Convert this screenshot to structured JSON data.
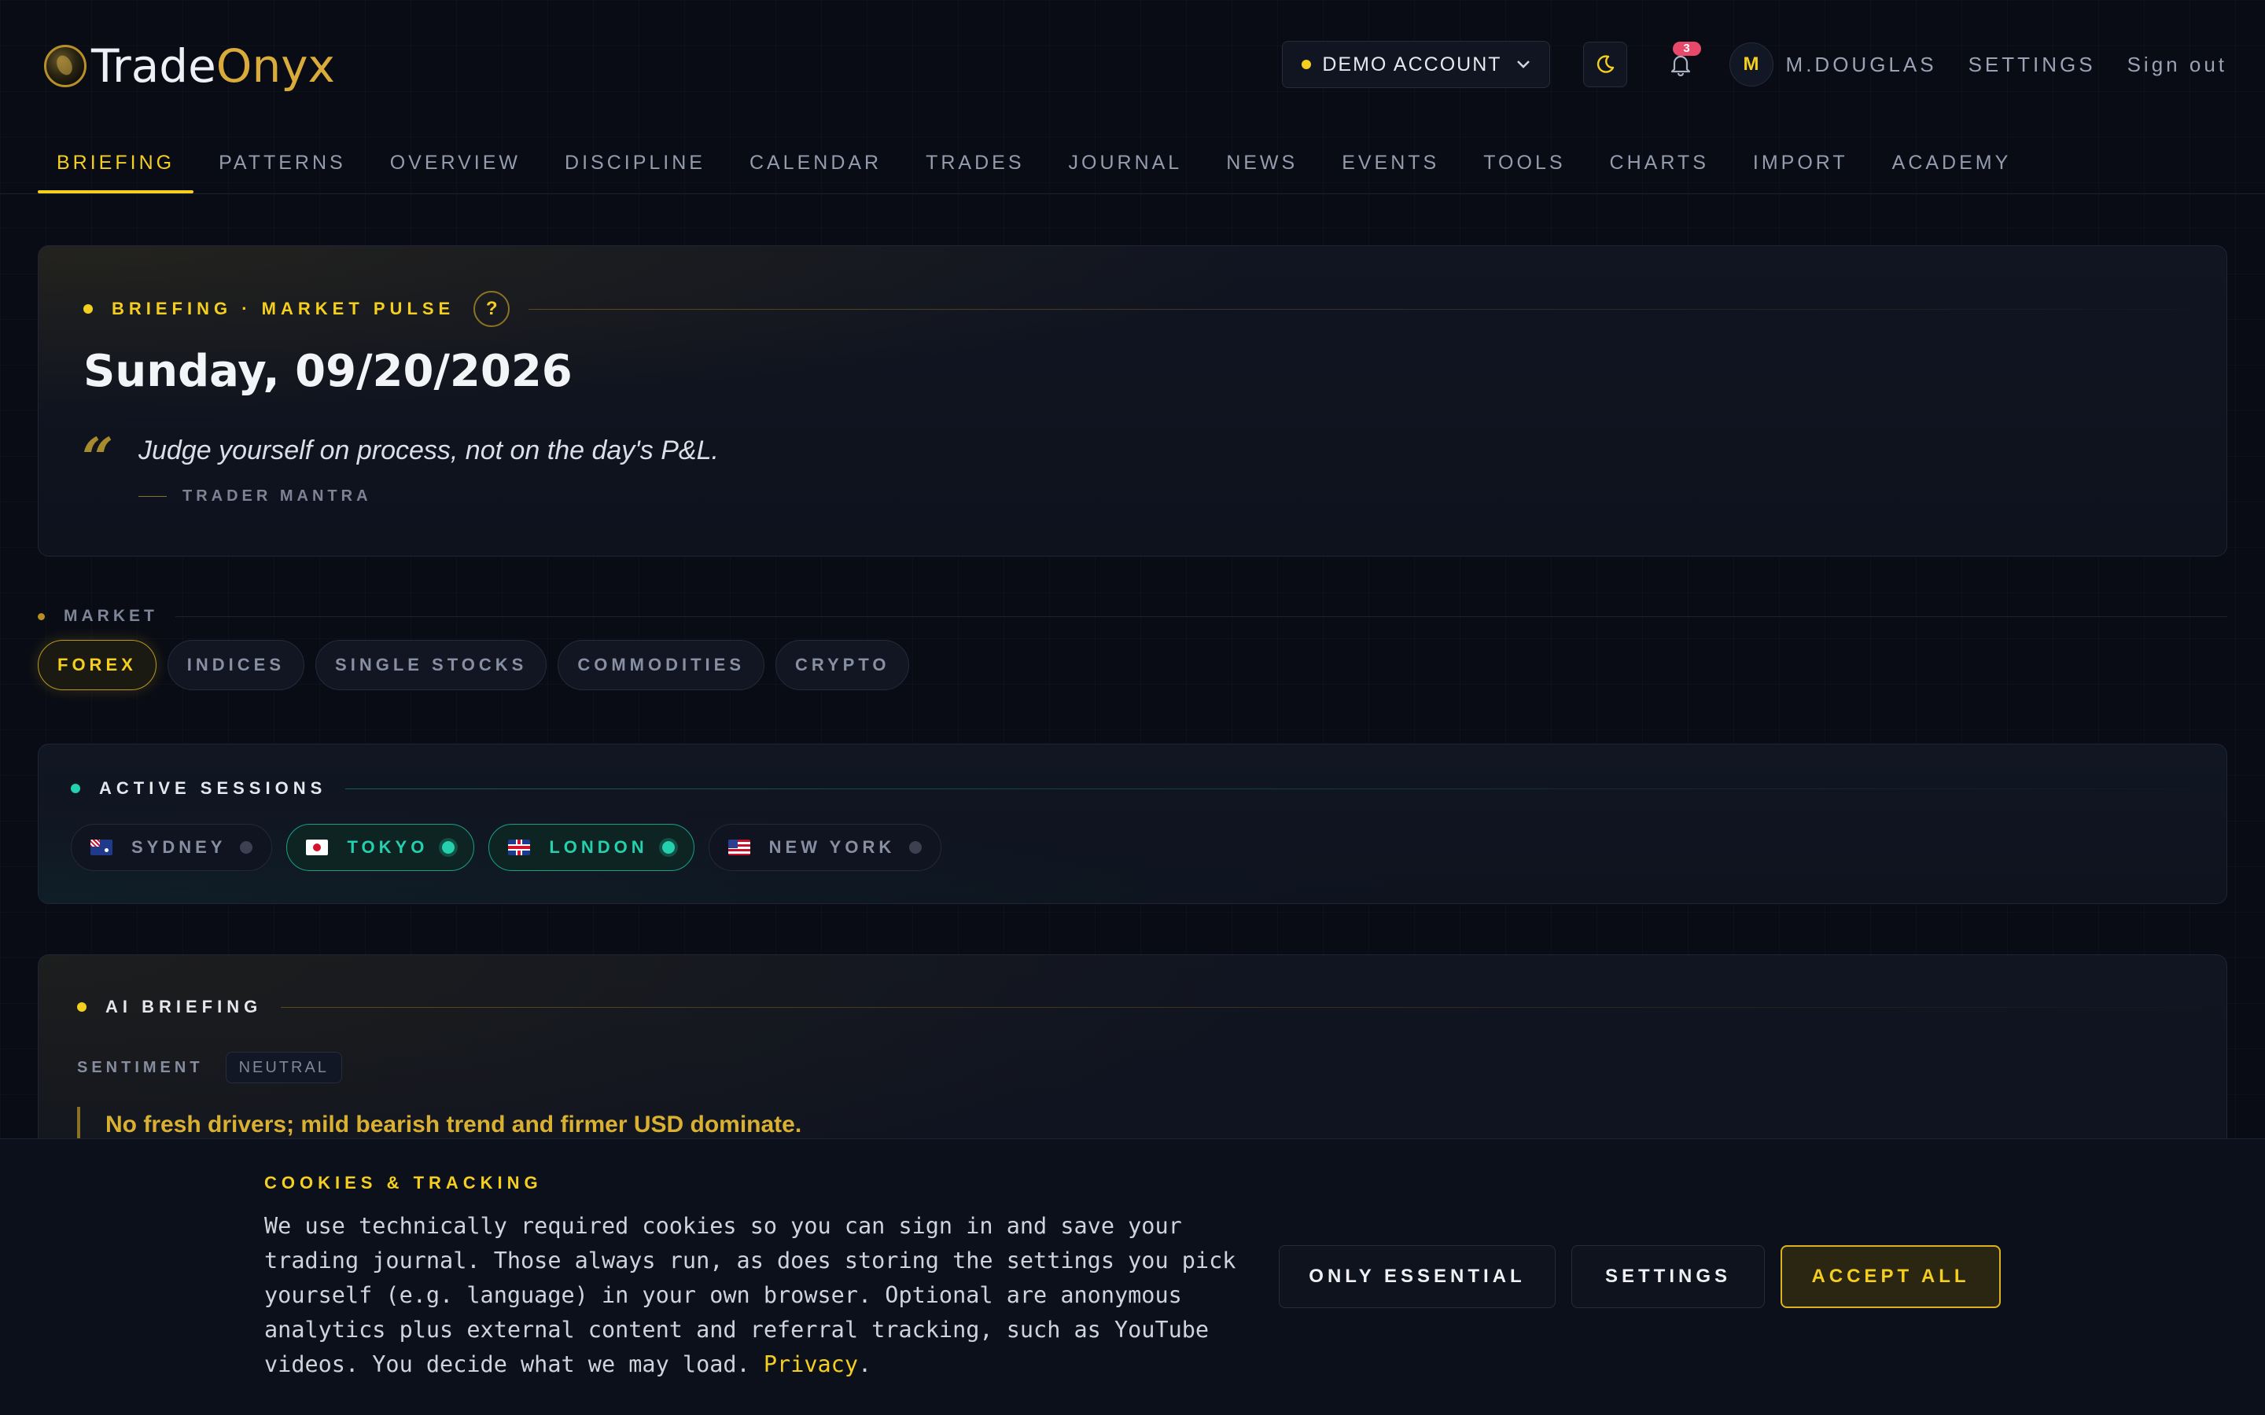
{
  "brand": {
    "part1": "Trade",
    "part2": "Onyx",
    "accent": "#d9ab3a"
  },
  "header": {
    "account_label": "DEMO ACCOUNT",
    "notifications_count": "3",
    "avatar_initial": "M",
    "username": "M.DOUGLAS",
    "settings_label": "SETTINGS",
    "signout_label": "Sign out",
    "icons": [
      "moon-icon",
      "bell-icon",
      "chevron-down-icon"
    ]
  },
  "nav": {
    "items": [
      "BRIEFING",
      "PATTERNS",
      "OVERVIEW",
      "DISCIPLINE",
      "CALENDAR",
      "TRADES",
      "JOURNAL",
      "NEWS",
      "EVENTS",
      "TOOLS",
      "CHARTS",
      "IMPORT",
      "ACADEMY"
    ],
    "active": "BRIEFING"
  },
  "pulse": {
    "eyebrow": "BRIEFING · MARKET PULSE",
    "help": "?",
    "date": "Sunday, 09/20/2026",
    "quote_mark": "“",
    "quote": "Judge yourself on process, not on the day's P&L.",
    "source": "TRADER MANTRA"
  },
  "market": {
    "label": "MARKET",
    "options": [
      "FOREX",
      "INDICES",
      "SINGLE STOCKS",
      "COMMODITIES",
      "CRYPTO"
    ],
    "selected": "FOREX"
  },
  "sessions": {
    "title": "ACTIVE SESSIONS",
    "items": [
      {
        "name": "SYDNEY",
        "active": false
      },
      {
        "name": "TOKYO",
        "active": true
      },
      {
        "name": "LONDON",
        "active": true
      },
      {
        "name": "NEW YORK",
        "active": false
      }
    ],
    "active_color": "#24d0ad"
  },
  "ai": {
    "title": "AI BRIEFING",
    "sentiment_label": "SENTIMENT",
    "sentiment_value": "NEUTRAL",
    "summary": "No fresh drivers; mild bearish trend and firmer USD dominate."
  },
  "cookie": {
    "title": "COOKIES & TRACKING",
    "text": "We use technically required cookies so you can sign in and save your trading journal. Those always run, as does storing the settings you pick yourself (e.g. language) in your own browser. Optional are anonymous analytics plus external content and referral tracking, such as YouTube videos. You decide what we may load.",
    "privacy_link": "Privacy",
    "period": ".",
    "buttons": {
      "essential": "ONLY ESSENTIAL",
      "settings": "SETTINGS",
      "accept": "ACCEPT ALL"
    }
  },
  "colors": {
    "accent": "#f5cf1f",
    "background": "#090c15",
    "session_active": "#24d0ad"
  }
}
